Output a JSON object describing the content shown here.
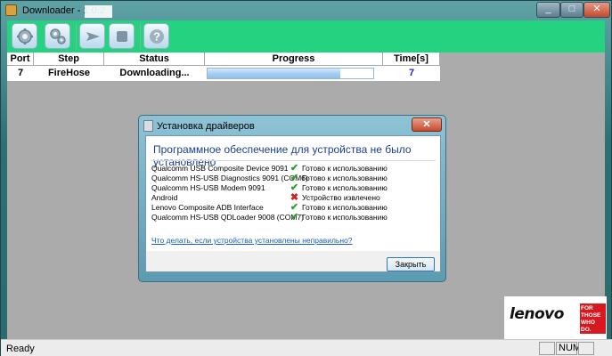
{
  "window": {
    "title": "Downloader - 1.0.2",
    "controls": {
      "minimize": "_",
      "maximize": "□",
      "close": "✕"
    }
  },
  "toolbar": {
    "buttons": [
      {
        "name": "settings",
        "icon": "gear-icon"
      },
      {
        "name": "port-settings",
        "icon": "gears-icon"
      },
      {
        "name": "start",
        "icon": "play-arrow-icon"
      },
      {
        "name": "stop",
        "icon": "stop-icon"
      },
      {
        "name": "help",
        "icon": "question-icon"
      }
    ],
    "color": "#25d27f"
  },
  "table": {
    "headers": [
      "Port",
      "Step",
      "Status",
      "Progress",
      "Time[s]"
    ],
    "rows": [
      {
        "port": "7",
        "step": "FireHose",
        "status": "Downloading...",
        "progress": 0.8,
        "time": "7"
      }
    ]
  },
  "dialog": {
    "title": "Установка драйверов",
    "close": "✕",
    "heading": "Программное обеспечение для устройства не было установлено",
    "devices": [
      {
        "name": "Qualcomm USB Composite Device 9091",
        "icon": "check-icon",
        "status": "Готово к использованию"
      },
      {
        "name": "Qualcomm HS-USB Diagnostics 9091 (COM6)",
        "icon": "check-icon",
        "status": "Готово к использованию"
      },
      {
        "name": "Qualcomm HS-USB Modem 9091",
        "icon": "check-icon",
        "status": "Готово к использованию"
      },
      {
        "name": "Android",
        "icon": "error-x-icon",
        "status": "Устройство извлечено"
      },
      {
        "name": "Lenovo Composite ADB Interface",
        "icon": "check-icon",
        "status": "Готово к использованию"
      },
      {
        "name": "Qualcomm HS-USB QDLoader 9008 (COM7)",
        "icon": "check-icon",
        "status": "Готово к использованию"
      }
    ],
    "link": "Что делать, если устройства установлены неправильно?",
    "button": "Закрыть"
  },
  "logo": {
    "word": "lenovo",
    "tagline": "FOR THOSE WHO DO."
  },
  "statusbar": {
    "text": "Ready",
    "num": "NUM"
  }
}
